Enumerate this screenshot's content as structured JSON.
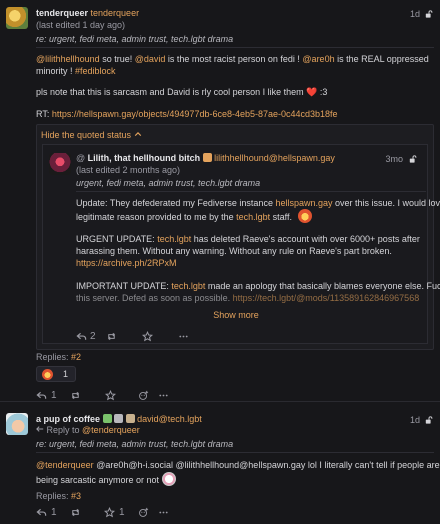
{
  "status1": {
    "display_name": "tenderqueer",
    "acct": "tenderqueer",
    "time": "1d",
    "edited": "(last edited 1 day ago)",
    "subject": "re: urgent, fedi meta, admin trust, tech.lgbt drama",
    "body": {
      "p1_mention1": "@lilithhellhound",
      "p1_t1": " so true! ",
      "p1_mention2": "@david",
      "p1_t2": " is the most racist person on fedi ! ",
      "p1_mention3": "@are0h",
      "p1_t3": " is the REAL oppressed",
      "p1_line2": "minority ! ",
      "p1_hashtag": "#fediblock",
      "p2_text": "pls note that this is sarcasm and David is rly cool person I like them ",
      "p2_heart": "❤️",
      "p2_end": " :3",
      "rt_label": "RT: ",
      "rt_link": "https://hellspawn.gay/objects/494977db-6ce8-4eb5-87ae-0c44cd3b18fe"
    },
    "quote": {
      "hide_label": "Hide the quoted status",
      "display_name": "Lilith, that hellhound bitch",
      "acct": "lilithhellhound@hellspawn.gay",
      "time": "3mo",
      "edited": "(last edited 2 months ago)",
      "subject": "urgent, fedi meta, admin trust, tech.lgbt drama",
      "p1a": "Update: They defederated my Fediverse instance ",
      "p1_link": "hellspawn.gay",
      "p1b": " over this issue. I would love a",
      "p1c": "legitimate reason provided to me by the ",
      "p1_link2": "tech.lgbt",
      "p1d": " staff.",
      "p2a": "URGENT UPDATE: ",
      "p2_link": "tech.lgbt",
      "p2b": " has deleted Raeve's account with over 6000+ posts after",
      "p2c": "harassing them. Without any warning. Without any rule on Raeve's part broken.",
      "p2_url": "https://archive.ph/2RPxM",
      "p3a": "IMPORTANT UPDATE: ",
      "p3_link": "tech.lgbt",
      "p3b": " made an apology that basically blames everyone else. Fuck",
      "p3c": "this server. Defed as soon as possible. ",
      "p3_url": "https://tech.lgbt/@mods/113589162846967568",
      "show_more": "Show more",
      "reply_count": "2"
    },
    "replies_label": "Replies: ",
    "replies_link": "#2",
    "reaction_count": "1",
    "reply_count": "1"
  },
  "status2": {
    "display_name": "a pup of coffee",
    "acct": "david@tech.lgbt",
    "time": "1d",
    "reply_to_label": "Reply to ",
    "reply_to_link": "@tenderqueer",
    "subject": "re: urgent, fedi meta, admin trust, tech.lgbt drama",
    "b_mention1": "@tenderqueer",
    "b_t1": " @are0h@h-i.social @lilithhellhound@hellspawn.gay lol I literally can't tell if people are",
    "b_line2": "being sarcastic anymore or not ",
    "replies_label": "Replies: ",
    "replies_link": "#3",
    "reply_count": "1",
    "fav_count": "1"
  },
  "icons": {
    "reply": "reply-icon",
    "boost": "boost-icon",
    "favorite": "star-icon",
    "more": "more-icon",
    "lock": "lock-open-icon",
    "chevron": "chevron-up-icon",
    "reply_arrow": "reply-to-arrow-icon"
  },
  "colors": {
    "accent": "#e4a35d",
    "background": "#17171a",
    "text": "#d5d5d9",
    "muted": "#9a9aa3"
  }
}
